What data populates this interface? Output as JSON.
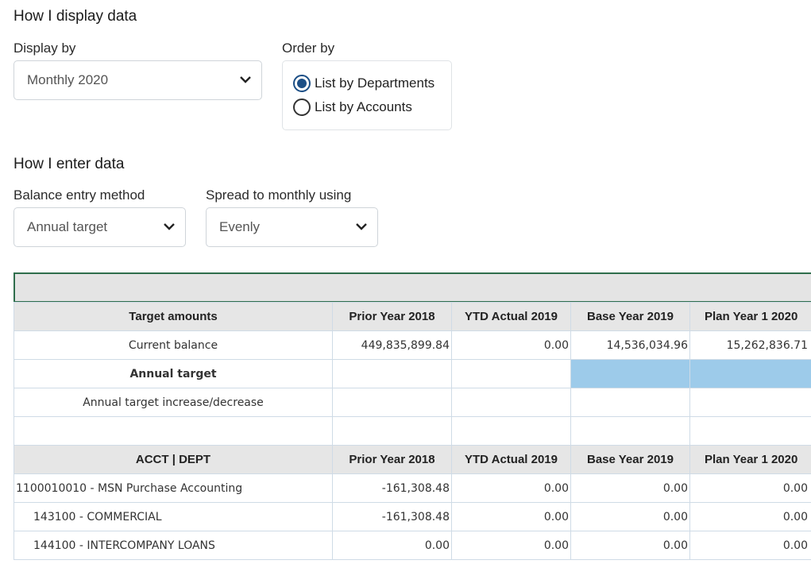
{
  "display_section": {
    "title": "How I display data",
    "display_by": {
      "label": "Display by",
      "value": "Monthly 2020"
    },
    "order_by": {
      "label": "Order by",
      "options": [
        "List by Departments",
        "List by Accounts"
      ],
      "selected": "List by Departments"
    }
  },
  "enter_section": {
    "title": "How I enter data",
    "balance_method": {
      "label": "Balance entry method",
      "value": "Annual target"
    },
    "spread": {
      "label": "Spread to monthly using",
      "value": "Evenly"
    }
  },
  "grid": {
    "columns": [
      "Prior Year 2018",
      "YTD Actual 2019",
      "Base Year 2019",
      "Plan Year 1 2020"
    ],
    "target_header": "Target amounts",
    "target_rows": [
      {
        "label": "Current balance",
        "values": [
          "449,835,899.84",
          "0.00",
          "14,536,034.96",
          "15,262,836.71"
        ]
      },
      {
        "label": "Annual target",
        "values": [
          "",
          "",
          "",
          ""
        ]
      },
      {
        "label": "Annual target increase/decrease",
        "values": [
          "",
          "",
          "",
          ""
        ]
      },
      {
        "label": "",
        "values": [
          "",
          "",
          "",
          ""
        ]
      }
    ],
    "acct_header": "ACCT | DEPT",
    "acct_rows": [
      {
        "label": "1100010010 - MSN Purchase Accounting",
        "values": [
          "-161,308.48",
          "0.00",
          "0.00",
          "0.00"
        ]
      },
      {
        "label": "143100 - COMMERCIAL",
        "values": [
          "-161,308.48",
          "0.00",
          "0.00",
          "0.00"
        ]
      },
      {
        "label": "144100 - INTERCOMPANY LOANS",
        "values": [
          "0.00",
          "0.00",
          "0.00",
          "0.00"
        ]
      }
    ]
  }
}
